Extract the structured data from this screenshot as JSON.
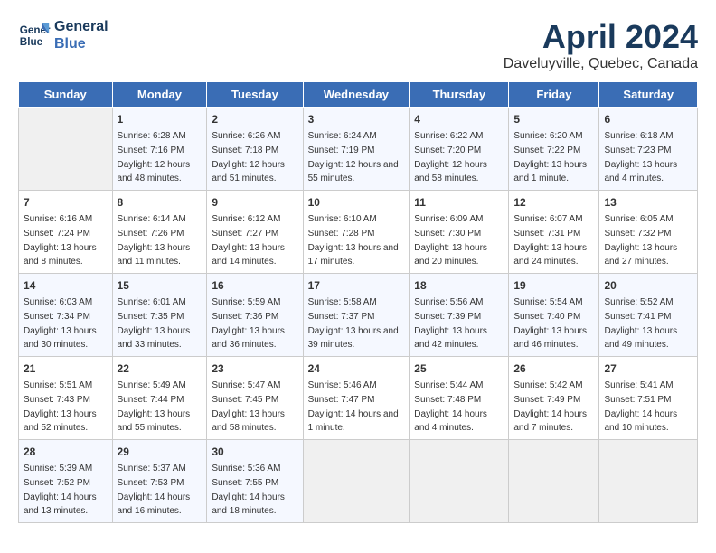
{
  "header": {
    "logo_line1": "General",
    "logo_line2": "Blue",
    "month": "April 2024",
    "location": "Daveluyville, Quebec, Canada"
  },
  "weekdays": [
    "Sunday",
    "Monday",
    "Tuesday",
    "Wednesday",
    "Thursday",
    "Friday",
    "Saturday"
  ],
  "weeks": [
    [
      {
        "day": "",
        "empty": true
      },
      {
        "day": "1",
        "sunrise": "6:28 AM",
        "sunset": "7:16 PM",
        "daylight": "12 hours and 48 minutes."
      },
      {
        "day": "2",
        "sunrise": "6:26 AM",
        "sunset": "7:18 PM",
        "daylight": "12 hours and 51 minutes."
      },
      {
        "day": "3",
        "sunrise": "6:24 AM",
        "sunset": "7:19 PM",
        "daylight": "12 hours and 55 minutes."
      },
      {
        "day": "4",
        "sunrise": "6:22 AM",
        "sunset": "7:20 PM",
        "daylight": "12 hours and 58 minutes."
      },
      {
        "day": "5",
        "sunrise": "6:20 AM",
        "sunset": "7:22 PM",
        "daylight": "13 hours and 1 minute."
      },
      {
        "day": "6",
        "sunrise": "6:18 AM",
        "sunset": "7:23 PM",
        "daylight": "13 hours and 4 minutes."
      }
    ],
    [
      {
        "day": "7",
        "sunrise": "6:16 AM",
        "sunset": "7:24 PM",
        "daylight": "13 hours and 8 minutes."
      },
      {
        "day": "8",
        "sunrise": "6:14 AM",
        "sunset": "7:26 PM",
        "daylight": "13 hours and 11 minutes."
      },
      {
        "day": "9",
        "sunrise": "6:12 AM",
        "sunset": "7:27 PM",
        "daylight": "13 hours and 14 minutes."
      },
      {
        "day": "10",
        "sunrise": "6:10 AM",
        "sunset": "7:28 PM",
        "daylight": "13 hours and 17 minutes."
      },
      {
        "day": "11",
        "sunrise": "6:09 AM",
        "sunset": "7:30 PM",
        "daylight": "13 hours and 20 minutes."
      },
      {
        "day": "12",
        "sunrise": "6:07 AM",
        "sunset": "7:31 PM",
        "daylight": "13 hours and 24 minutes."
      },
      {
        "day": "13",
        "sunrise": "6:05 AM",
        "sunset": "7:32 PM",
        "daylight": "13 hours and 27 minutes."
      }
    ],
    [
      {
        "day": "14",
        "sunrise": "6:03 AM",
        "sunset": "7:34 PM",
        "daylight": "13 hours and 30 minutes."
      },
      {
        "day": "15",
        "sunrise": "6:01 AM",
        "sunset": "7:35 PM",
        "daylight": "13 hours and 33 minutes."
      },
      {
        "day": "16",
        "sunrise": "5:59 AM",
        "sunset": "7:36 PM",
        "daylight": "13 hours and 36 minutes."
      },
      {
        "day": "17",
        "sunrise": "5:58 AM",
        "sunset": "7:37 PM",
        "daylight": "13 hours and 39 minutes."
      },
      {
        "day": "18",
        "sunrise": "5:56 AM",
        "sunset": "7:39 PM",
        "daylight": "13 hours and 42 minutes."
      },
      {
        "day": "19",
        "sunrise": "5:54 AM",
        "sunset": "7:40 PM",
        "daylight": "13 hours and 46 minutes."
      },
      {
        "day": "20",
        "sunrise": "5:52 AM",
        "sunset": "7:41 PM",
        "daylight": "13 hours and 49 minutes."
      }
    ],
    [
      {
        "day": "21",
        "sunrise": "5:51 AM",
        "sunset": "7:43 PM",
        "daylight": "13 hours and 52 minutes."
      },
      {
        "day": "22",
        "sunrise": "5:49 AM",
        "sunset": "7:44 PM",
        "daylight": "13 hours and 55 minutes."
      },
      {
        "day": "23",
        "sunrise": "5:47 AM",
        "sunset": "7:45 PM",
        "daylight": "13 hours and 58 minutes."
      },
      {
        "day": "24",
        "sunrise": "5:46 AM",
        "sunset": "7:47 PM",
        "daylight": "14 hours and 1 minute."
      },
      {
        "day": "25",
        "sunrise": "5:44 AM",
        "sunset": "7:48 PM",
        "daylight": "14 hours and 4 minutes."
      },
      {
        "day": "26",
        "sunrise": "5:42 AM",
        "sunset": "7:49 PM",
        "daylight": "14 hours and 7 minutes."
      },
      {
        "day": "27",
        "sunrise": "5:41 AM",
        "sunset": "7:51 PM",
        "daylight": "14 hours and 10 minutes."
      }
    ],
    [
      {
        "day": "28",
        "sunrise": "5:39 AM",
        "sunset": "7:52 PM",
        "daylight": "14 hours and 13 minutes."
      },
      {
        "day": "29",
        "sunrise": "5:37 AM",
        "sunset": "7:53 PM",
        "daylight": "14 hours and 16 minutes."
      },
      {
        "day": "30",
        "sunrise": "5:36 AM",
        "sunset": "7:55 PM",
        "daylight": "14 hours and 18 minutes."
      },
      {
        "day": "",
        "empty": true
      },
      {
        "day": "",
        "empty": true
      },
      {
        "day": "",
        "empty": true
      },
      {
        "day": "",
        "empty": true
      }
    ]
  ],
  "labels": {
    "sunrise": "Sunrise:",
    "sunset": "Sunset:",
    "daylight": "Daylight:"
  }
}
